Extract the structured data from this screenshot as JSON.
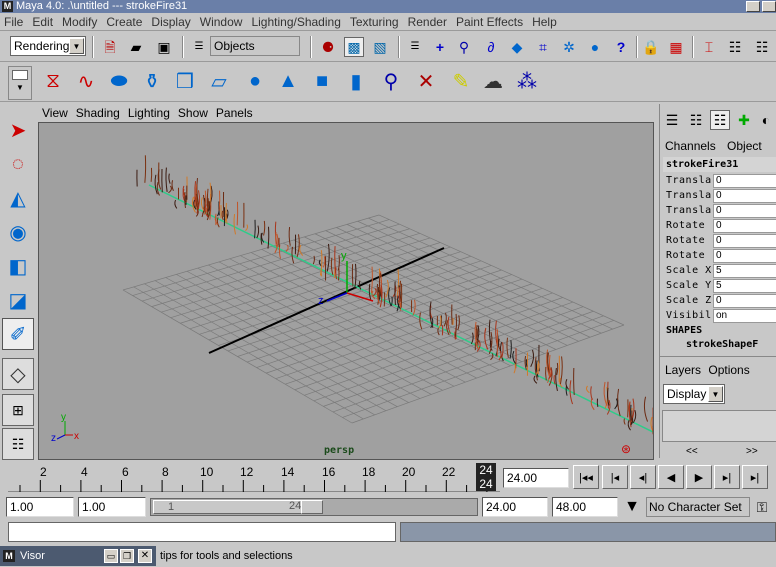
{
  "window": {
    "title": "Maya 4.0: .\\untitled   ---   strokeFire31"
  },
  "menubar": [
    "File",
    "Edit",
    "Modify",
    "Create",
    "Display",
    "Window",
    "Lighting/Shading",
    "Texturing",
    "Render",
    "Paint Effects",
    "Help"
  ],
  "status_line": {
    "menu_set": "Rendering",
    "selection_mode": "Objects"
  },
  "viewport": {
    "menus": [
      "View",
      "Shading",
      "Lighting",
      "Show",
      "Panels"
    ],
    "camera_label": "persp",
    "axis": {
      "x": "x",
      "y": "y",
      "z": "z"
    },
    "manipulator": {
      "y": "y",
      "z": "z"
    }
  },
  "channel_box": {
    "tabs": [
      "Channels",
      "Object"
    ],
    "object_name": "strokeFire31",
    "channels": [
      {
        "label": "Transla",
        "value": "0"
      },
      {
        "label": "Transla",
        "value": "0"
      },
      {
        "label": "Transla",
        "value": "0"
      },
      {
        "label": "Rotate",
        "value": "0"
      },
      {
        "label": "Rotate",
        "value": "0"
      },
      {
        "label": "Rotate",
        "value": "0"
      },
      {
        "label": "Scale X",
        "value": "5"
      },
      {
        "label": "Scale Y",
        "value": "5"
      },
      {
        "label": "Scale Z",
        "value": "0"
      },
      {
        "label": "Visibil",
        "value": "on"
      }
    ],
    "shapes_header": "SHAPES",
    "shape_name": "strokeShapeF"
  },
  "layer_editor": {
    "menus": [
      "Layers",
      "Options"
    ],
    "display_option": "Display",
    "nav_prev": "<<",
    "nav_next": ">>"
  },
  "time_slider": {
    "ticks": [
      "2",
      "4",
      "6",
      "8",
      "10",
      "12",
      "14",
      "16",
      "18",
      "20",
      "22"
    ],
    "current_frame_top": "24",
    "current_frame_bottom": "24",
    "current_time": "24.00"
  },
  "range_slider": {
    "start": "1.00",
    "playback_start": "1.00",
    "range_left_label": "1",
    "range_right_label": "24",
    "playback_end": "24.00",
    "end": "48.00",
    "character_set": "No Character Set"
  },
  "help_line": {
    "visor_label": "Visor",
    "text": "tips for tools and selections"
  }
}
